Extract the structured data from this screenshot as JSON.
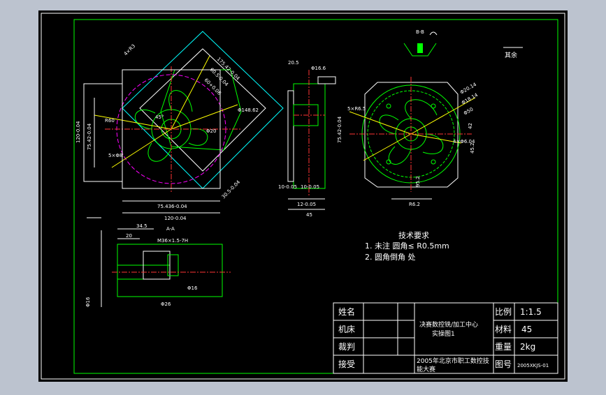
{
  "sheet": {
    "section_label": "B-B",
    "roughness_note": "其余",
    "dims": {
      "d1": "175.42-0.04",
      "d2": "60.5-0.04",
      "d3": "60+0.06",
      "d4": "4×R3",
      "d5": "Φ148.62",
      "d6": "R60",
      "d7": "45°",
      "d8": "75.42-0.04",
      "d9": "120-0.04",
      "d10": "5×Φ8",
      "d11": "Φ20",
      "d12": "75.436-0.04",
      "d13": "120-0.04",
      "d14": "30.5-0.04",
      "d15": "Φ16.6",
      "d16": "20.5",
      "d17": "75.42-0.04",
      "d18": "10-0.05",
      "d19": "10-0.05",
      "d20": "12-0.05",
      "d21": "45",
      "d22": "5×R6.5",
      "d23": "Φ20.14",
      "d24": "Φ18.14",
      "d25": "Φ50",
      "d26": "42",
      "d27": "4×Φ6.04",
      "d28": "45.2",
      "d29": "95.2",
      "d30": "R6.2",
      "d31": "34.5",
      "d32": "20",
      "d33": "M36×1.5-7H",
      "d34": "Φ16",
      "d35": "Φ26",
      "d36": "A-A",
      "d37": "Φ16"
    }
  },
  "requirements": {
    "title": "技术要求",
    "line1": "1. 未注 圆角≤ R0.5mm",
    "line2": "2. 圆角倒角 处"
  },
  "title_block": {
    "row1_label": "姓名",
    "row2_label": "机床",
    "row3_label": "裁判",
    "row4_label": "接受",
    "part_name_1": "决赛数控铣/加工中心",
    "part_name_2": "实操图1",
    "org_1": "2005年北京市职工数控技",
    "org_2": "能大赛",
    "scale_label": "比例",
    "scale_value": "1:1.5",
    "material_label": "材料",
    "material_value": "45",
    "weight_label": "重量",
    "weight_value": "2kg",
    "drawing_no_label": "图号",
    "drawing_no_value": "2005XKJS-01"
  }
}
